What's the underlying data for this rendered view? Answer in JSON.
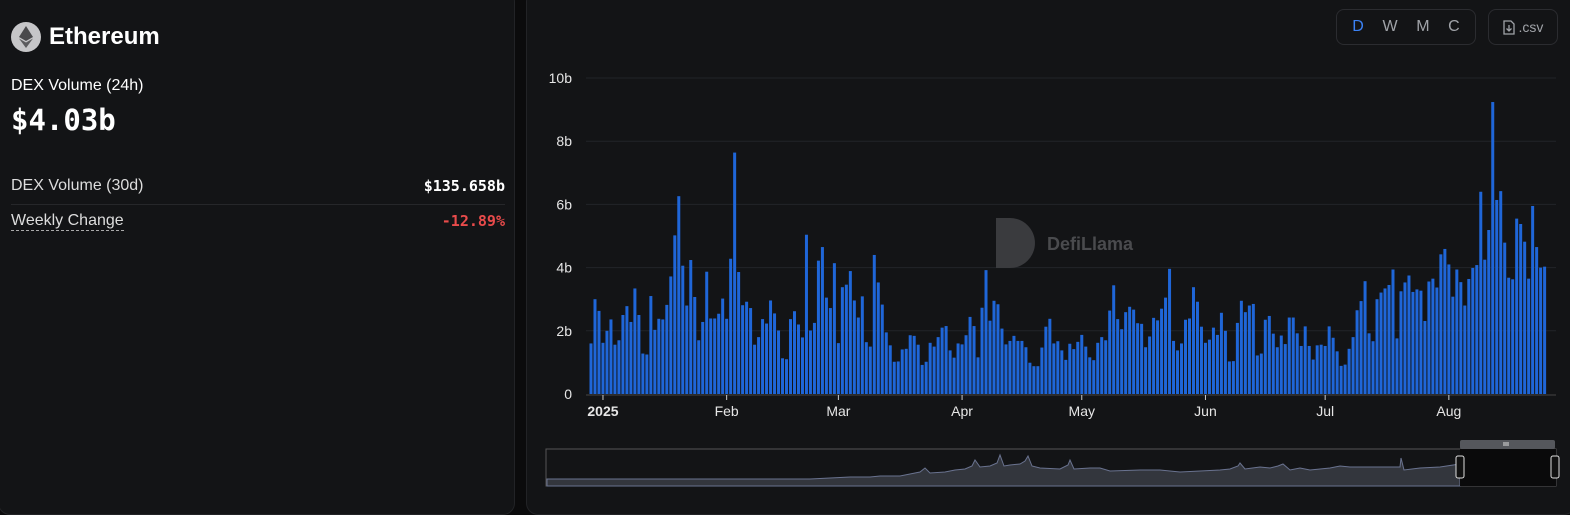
{
  "header": {
    "title": "Ethereum",
    "icon": "ethereum-logo-icon"
  },
  "stats": {
    "dex_volume_24h_label": "DEX Volume (24h)",
    "dex_volume_24h_value": "$4.03b",
    "dex_volume_30d_label": "DEX Volume (30d)",
    "dex_volume_30d_value": "$135.658b",
    "weekly_change_label": "Weekly Change",
    "weekly_change_value": "-12.89%"
  },
  "toolbar": {
    "granularity": [
      "D",
      "W",
      "M",
      "C"
    ],
    "selected_granularity": "D",
    "csv_label": ".csv"
  },
  "watermark": "DefiLlama",
  "colors": {
    "bar": "#1f66d8",
    "negative": "#e94b4b",
    "accent": "#3b82f6"
  },
  "chart_data": {
    "type": "bar",
    "title": "",
    "xlabel": "",
    "ylabel": "DEX Volume",
    "start_date": "2024-12-29",
    "interval": "daily",
    "yunit": "b",
    "ylim": [
      0,
      10
    ],
    "yticks": [
      "0",
      "2b",
      "4b",
      "6b",
      "8b",
      "10b"
    ],
    "xticks": [
      {
        "label": "2025",
        "index": 3
      },
      {
        "label": "Feb",
        "index": 34
      },
      {
        "label": "Mar",
        "index": 62
      },
      {
        "label": "Apr",
        "index": 93
      },
      {
        "label": "May",
        "index": 123
      },
      {
        "label": "Jun",
        "index": 154
      },
      {
        "label": "Jul",
        "index": 184
      },
      {
        "label": "Aug",
        "index": 215
      }
    ],
    "grid": true,
    "values": [
      1.6,
      3.0,
      2.63,
      1.62,
      2.0,
      2.36,
      1.56,
      1.7,
      2.5,
      2.78,
      2.28,
      3.34,
      2.5,
      1.28,
      1.25,
      3.1,
      2.03,
      2.38,
      2.36,
      2.82,
      3.72,
      5.02,
      6.26,
      4.06,
      2.8,
      4.24,
      3.07,
      1.7,
      2.28,
      3.87,
      2.39,
      2.39,
      2.54,
      3.02,
      2.38,
      4.28,
      7.64,
      3.86,
      2.81,
      2.92,
      2.72,
      1.56,
      1.8,
      2.37,
      2.23,
      2.96,
      2.55,
      2.01,
      1.13,
      1.1,
      2.37,
      2.62,
      2.2,
      1.79,
      5.04,
      2.01,
      2.25,
      4.22,
      4.65,
      3.05,
      2.72,
      4.14,
      1.61,
      3.38,
      3.46,
      3.89,
      2.96,
      2.42,
      3.09,
      1.64,
      1.5,
      4.4,
      3.53,
      2.83,
      1.95,
      1.54,
      1.02,
      1.03,
      1.41,
      1.43,
      1.86,
      1.84,
      1.56,
      0.92,
      1.02,
      1.62,
      1.5,
      1.8,
      2.1,
      2.15,
      1.38,
      1.15,
      1.6,
      1.57,
      1.86,
      2.44,
      2.15,
      1.16,
      2.73,
      3.92,
      2.32,
      2.95,
      2.84,
      2.07,
      1.57,
      1.68,
      1.84,
      1.68,
      1.68,
      1.48,
      0.99,
      0.88,
      0.88,
      1.47,
      2.13,
      2.38,
      1.6,
      1.67,
      1.38,
      1.08,
      1.59,
      1.42,
      1.65,
      1.87,
      1.5,
      1.16,
      1.07,
      1.62,
      1.8,
      1.7,
      2.64,
      3.44,
      2.37,
      2.05,
      2.59,
      2.76,
      2.67,
      2.24,
      2.22,
      1.48,
      1.82,
      2.41,
      2.33,
      2.7,
      3.05,
      3.96,
      1.68,
      1.38,
      1.6,
      2.35,
      2.39,
      3.38,
      2.92,
      2.13,
      1.62,
      1.72,
      2.1,
      1.87,
      2.57,
      2.0,
      1.03,
      1.04,
      2.25,
      2.95,
      2.59,
      2.8,
      2.85,
      1.22,
      1.28,
      2.35,
      2.47,
      1.91,
      1.48,
      1.85,
      1.58,
      2.42,
      2.42,
      1.92,
      1.52,
      2.14,
      1.52,
      1.09,
      1.54,
      1.56,
      1.52,
      2.14,
      1.78,
      1.35,
      0.89,
      0.93,
      1.43,
      1.8,
      2.65,
      2.94,
      3.57,
      1.92,
      1.67,
      3.0,
      3.21,
      3.34,
      3.45,
      3.94,
      1.76,
      3.25,
      3.53,
      3.75,
      3.23,
      3.31,
      3.27,
      2.31,
      3.56,
      3.65,
      3.37,
      4.42,
      4.59,
      4.1,
      3.08,
      3.94,
      3.54,
      2.8,
      3.64,
      3.99,
      4.08,
      6.4,
      4.25,
      5.19,
      9.24,
      6.14,
      6.42,
      4.79,
      3.68,
      3.63,
      5.55,
      5.38,
      4.82,
      3.65,
      5.95,
      4.65,
      4.0,
      4.03
    ]
  }
}
